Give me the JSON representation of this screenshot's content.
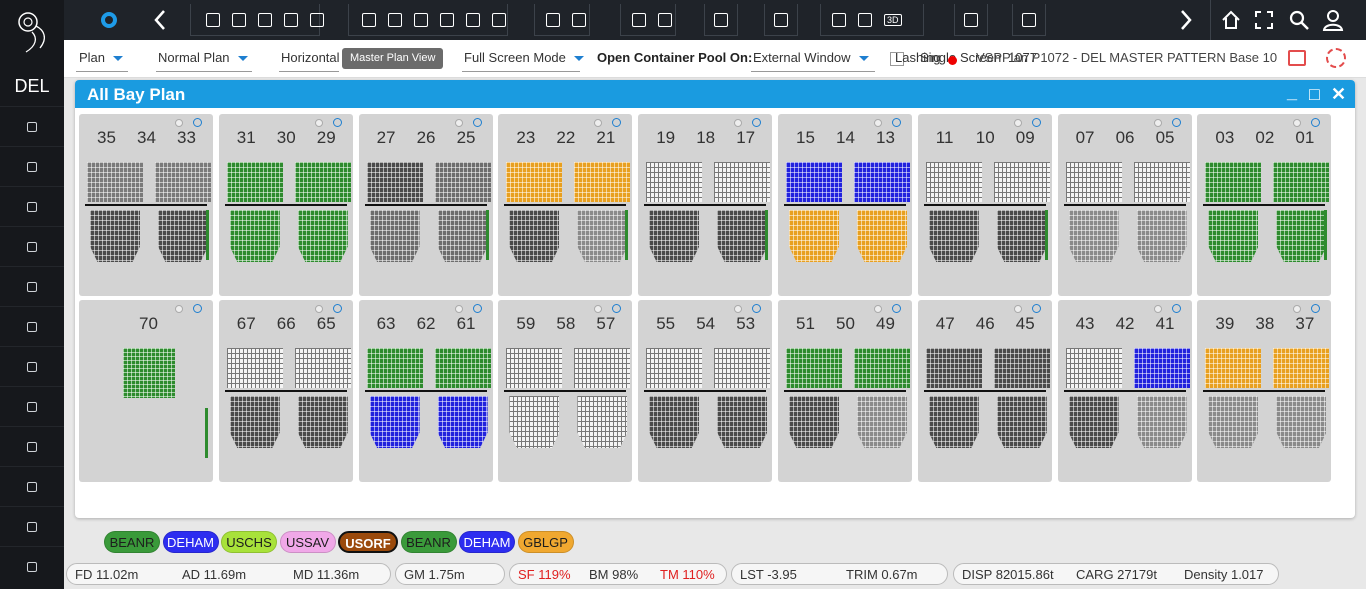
{
  "sidebar": {
    "port_code": "DEL",
    "items": [
      "doc-icon",
      "chat-icon",
      "eye-icon",
      "list-icon",
      "ship-icon",
      "image-icon",
      "sliders-icon",
      "diamond-icon",
      "cross-icon",
      "tools-icon",
      "gear-icon",
      "power-icon"
    ]
  },
  "topbar": {
    "icons": [
      "gear-icon",
      "back-icon",
      "folder-icon",
      "save-icon",
      "cloud-upload-icon",
      "download-icon",
      "export-icon",
      "layout-icon",
      "calendar-icon",
      "clipboard-icon",
      "stack-icon",
      "crane-icon",
      "hazard-icon",
      "cart-icon",
      "picture-icon",
      "route-icon",
      "chart-icon",
      "transfer-icon",
      "fire-icon",
      "color-icon",
      "palette-icon",
      "3d-icon",
      "report-icon",
      "cancel-icon",
      "forward-icon",
      "home-icon",
      "fullscreen-icon",
      "search-icon",
      "user-icon"
    ],
    "threed_label": "3D"
  },
  "options": {
    "view_select": "Plan",
    "plan_select": "Normal Plan",
    "orientation": "Horizontal",
    "master_plan_button": "Master Plan View",
    "screen_mode": "Full Screen Mode",
    "container_pool_label": "Open Container Pool On:",
    "container_pool_value": "External Window",
    "lashing_label": "Lashing",
    "single_label": "Single",
    "screen_overlap": "Screen",
    "voyage_info": "VSPPlan P1072 - DEL MASTER PATTERN Base 10",
    "voyage_overlap": "1077"
  },
  "panel": {
    "title": "All Bay Plan",
    "minimize": "_",
    "maximize": "□",
    "close": "✕"
  },
  "bays": {
    "row1": [
      {
        "labels": [
          "35",
          "34",
          "33"
        ]
      },
      {
        "labels": [
          "31",
          "30",
          "29"
        ]
      },
      {
        "labels": [
          "27",
          "26",
          "25"
        ]
      },
      {
        "labels": [
          "23",
          "22",
          "21"
        ]
      },
      {
        "labels": [
          "19",
          "18",
          "17"
        ]
      },
      {
        "labels": [
          "15",
          "14",
          "13"
        ]
      },
      {
        "labels": [
          "11",
          "10",
          "09"
        ]
      },
      {
        "labels": [
          "07",
          "06",
          "05"
        ]
      },
      {
        "labels": [
          "03",
          "02",
          "01"
        ]
      }
    ],
    "row2": [
      {
        "labels": [
          "70"
        ]
      },
      {
        "labels": [
          "67",
          "66",
          "65"
        ]
      },
      {
        "labels": [
          "63",
          "62",
          "61"
        ]
      },
      {
        "labels": [
          "59",
          "58",
          "57"
        ]
      },
      {
        "labels": [
          "55",
          "54",
          "53"
        ]
      },
      {
        "labels": [
          "51",
          "50",
          "49"
        ]
      },
      {
        "labels": [
          "47",
          "46",
          "45"
        ]
      },
      {
        "labels": [
          "43",
          "42",
          "41"
        ]
      },
      {
        "labels": [
          "39",
          "38",
          "37"
        ]
      }
    ]
  },
  "ports": [
    {
      "code": "BEANR",
      "color": "#3a9a3a",
      "text": "#1d1d1d",
      "bold": false
    },
    {
      "code": "DEHAM",
      "color": "#2d2df0",
      "text": "#ffffff",
      "bold": false
    },
    {
      "code": "USCHS",
      "color": "#a8e23a",
      "text": "#1d1d1d",
      "bold": false
    },
    {
      "code": "USSAV",
      "color": "#f0a8e8",
      "text": "#1d1d1d",
      "bold": false
    },
    {
      "code": "USORF",
      "color": "#9b4a0c",
      "text": "#ffffff",
      "bold": true
    },
    {
      "code": "BEANR",
      "color": "#3a9a3a",
      "text": "#1d1d1d",
      "bold": false
    },
    {
      "code": "DEHAM",
      "color": "#2d2df0",
      "text": "#ffffff",
      "bold": false
    },
    {
      "code": "GBLGP",
      "color": "#f0a830",
      "text": "#1d1d1d",
      "bold": false
    }
  ],
  "stats": {
    "fd": "FD 11.02m",
    "ad": "AD 11.69m",
    "md": "MD 11.36m",
    "gm": "GM 1.75m",
    "sf": "SF 119%",
    "bm": "BM 98%",
    "tm": "TM 110%",
    "lst": "LST -3.95",
    "trim": "TRIM 0.67m",
    "disp": "DISP 82015.86t",
    "carg": "CARG 27179t",
    "density": "Density 1.017"
  },
  "colors": {
    "accent": "#1a9be0",
    "beanr": "#2e8b2e",
    "deham": "#2222dd",
    "gblgp": "#e8a020",
    "dark_cell": "#4a4a4a",
    "empty_cell": "#f2f2f2"
  }
}
